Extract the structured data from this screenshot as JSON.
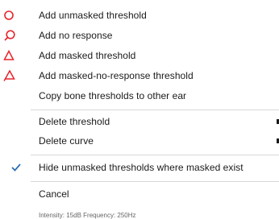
{
  "menu": {
    "items": [
      {
        "label": "Add unmasked threshold",
        "icon": "red-circle-icon"
      },
      {
        "label": "Add no response",
        "icon": "red-circle-no-response-icon"
      },
      {
        "label": "Add masked threshold",
        "icon": "red-triangle-icon"
      },
      {
        "label": "Add masked-no-response threshold",
        "icon": "red-triangle-no-response-icon"
      },
      {
        "label": "Copy bone thresholds to other ear"
      },
      {
        "label": "Delete threshold",
        "submenu": true
      },
      {
        "label": "Delete curve",
        "submenu": true
      },
      {
        "label": "Hide unmasked thresholds where masked exist",
        "checked": true
      },
      {
        "label": "Cancel"
      }
    ]
  },
  "status_text": "Intensity: 15dB Frequency: 250Hz",
  "colors": {
    "marker_red": "#e8242b",
    "check_blue": "#2f6fb5",
    "separator": "#d7d7d7"
  }
}
